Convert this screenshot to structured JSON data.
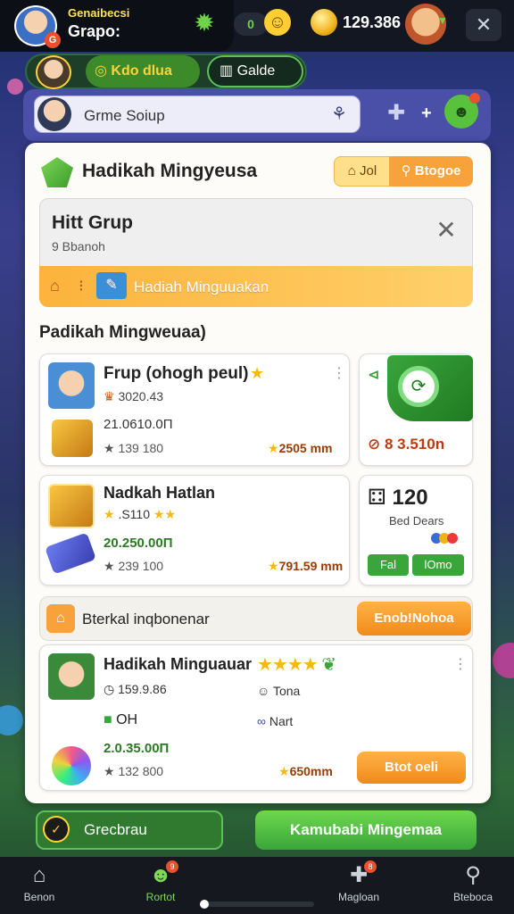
{
  "topbar": {
    "name_top": "Genaibecsi",
    "name": "Grapo:",
    "avatar_badge": "G",
    "pill_value": "0",
    "coins": "129.386"
  },
  "tabs": [
    {
      "label": "Kdo dlua"
    },
    {
      "label": "Galde"
    }
  ],
  "search": {
    "placeholder": "Grme Soiup"
  },
  "panel": {
    "title": "Hadikah Mingyeusa",
    "btn1": "Jol",
    "btn2": "Btogoe"
  },
  "group": {
    "title": "Hitt Grup",
    "subtitle": "9 Bbanoh",
    "banner_text": "Hadiah Minguuakan"
  },
  "section_title": "Padikah Mingweuaa)",
  "cards": {
    "c1": {
      "title": "Frup (ohogh peul)",
      "meta": "3020.43",
      "value": "21.0610.0П",
      "stat": "139 180",
      "points": "2505 mm"
    },
    "c2": {
      "value": "3.510n",
      "prefix": "8"
    },
    "c3": {
      "title": "Nadkah Hatlan",
      "meta": ".S110",
      "value": "20.250.00П",
      "stat": "239 100",
      "points": "791.59 mm"
    },
    "c4": {
      "number": "120",
      "label": "Bed Dears",
      "btn1": "Fal",
      "btn2": "lOmo",
      "dot_colors": [
        "#3a6ad6",
        "#f0b21c",
        "#e83a3a"
      ]
    }
  },
  "section2": {
    "title": "Bterkal inqbonenar",
    "button": "Enob!Nohoa"
  },
  "card5": {
    "title": "Hadikah Minguauar",
    "m1": "159.9.86",
    "m2": "Tona",
    "m3": "OH",
    "m4": "Nart",
    "cash": "2.0.35.00П",
    "stat": "132 800",
    "points": "650mm",
    "button": "Btot oeli",
    "stars": "★★★★"
  },
  "actions": {
    "left": "Grecbrau",
    "right": "Kamubabi Mingemaa"
  },
  "nav": [
    {
      "label": "Benon",
      "icon": "home-icon"
    },
    {
      "label": "Rortot",
      "icon": "monster-icon",
      "badge": "9"
    },
    {
      "label": "Magloan",
      "icon": "puzzle-icon",
      "badge": "8"
    },
    {
      "label": "Bteboca",
      "icon": "search-icon"
    }
  ],
  "nav_progress": 0.04,
  "colors": {
    "accent_green": "#3aa53a",
    "accent_orange": "#f08a1a",
    "header_bg": "#121722"
  }
}
